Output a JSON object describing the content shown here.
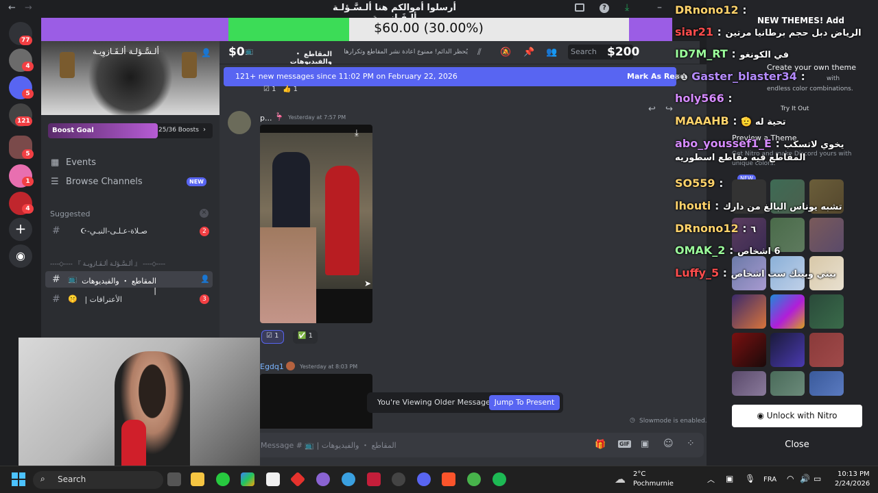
{
  "titlebar": {
    "back_arrow": "←",
    "forward_arrow": "→",
    "title": "أرسلوا أموالكم هنا ألـسَّـؤلـة ألـفَـازوِيـة"
  },
  "server_rail": {
    "badges": [
      "77",
      "4",
      "5",
      "121",
      "5",
      "1",
      "4"
    ]
  },
  "sidebar": {
    "server_name": "ألـسَّـؤلـة ألـفَـازوِيـة",
    "boost_goal_label": "Boost Goal",
    "boost_count": "25/36 Boosts",
    "events_label": "Events",
    "browse_channels_label": "Browse Channels",
    "new_badge": "NEW",
    "suggested_label": "Suggested",
    "suggested_channel": "صـلاة-عـلـى-النبـي-☪",
    "suggested_badge": "2",
    "category_label": "----◇---- 『 ألـسَّـؤلـة ألـفَـازوِيـة 』 ----◇----",
    "channels": [
      {
        "name": "المقاطع ・ والفيديوهات |",
        "badge": ""
      },
      {
        "name": "الأعترافات |",
        "badge": "3"
      }
    ]
  },
  "goal_bar": {
    "text": "$60.00 (30.00%)",
    "progress_pct": 30
  },
  "channel_header": {
    "left_amount": "$0",
    "channel_name": "المقاطع ・ والفيديوهات",
    "topic": "يُحظر الدائم! ممنوع اعادة نشر المقاطع وتكرارها",
    "right_amount": "$200",
    "search_placeholder": "Search"
  },
  "chat": {
    "new_messages_banner": "121+ new messages since 11:02 PM on February 22, 2026",
    "mark_as_read": "Mark As Read",
    "messages": [
      {
        "username": "p...",
        "timestamp": "Yesterday at 7:57 PM",
        "reactions": [
          {
            "emoji": "☑",
            "count": "1"
          },
          {
            "emoji": "✅",
            "count": "1"
          }
        ]
      },
      {
        "username": "Egdq1",
        "timestamp": "Yesterday at 8:03 PM"
      }
    ],
    "older_messages_text": "You're Viewing Older Messages",
    "jump_to_present": "Jump To Present",
    "slowmode_text": "Slowmode is enabled.",
    "input_placeholder": "Message # 📺 | المقاطع ・ والفيديوهات"
  },
  "themes_panel": {
    "header": "NEW THEMES! Add",
    "promo_title": "Create your own theme",
    "promo_sub_1": "with",
    "promo_sub_2": "endless color combinations.",
    "try_it_out": "Try It Out",
    "preview_title": "Preview a Theme",
    "preview_sub": "Get Nitro and make Discord yours with unique colors.",
    "new_badge": "NEW",
    "unlock_nitro": "Unlock with Nitro",
    "close": "Close"
  },
  "chat_overlay": [
    {
      "user": "DRnono12",
      "color": "#ffd36b",
      "msg": ""
    },
    {
      "user": "siar21",
      "color": "#ff4d4d",
      "msg": "الرياض دبل حجم برطانيا مرتين"
    },
    {
      "user": "ID7M_RT",
      "color": "#9cff9c",
      "msg": "في الكونغو"
    },
    {
      "user": "Gaster_blaster34",
      "color": "#b58bff",
      "msg": ""
    },
    {
      "user": "holy566",
      "color": "#d68bff",
      "msg": ""
    },
    {
      "user": "MAAAHB",
      "color": "#ffd36b",
      "msg": "تحية له 🫡"
    },
    {
      "user": "abo_youssef1_E",
      "color": "#d68bff",
      "msg": "يخوي لاتسكب المقاطع فيه مقاطع اسطوريه"
    },
    {
      "user": "SO559",
      "color": "#ffd36b",
      "msg": ""
    },
    {
      "user": "lhouti",
      "color": "#ffd36b",
      "msg": "تشبه يوناس البالغ من دارك"
    },
    {
      "user": "DRnono12",
      "color": "#ffd36b",
      "msg": "٦"
    },
    {
      "user": "OMAK_2",
      "color": "#9cff9c",
      "msg": "6 اشخاص"
    },
    {
      "user": "Luffy_5",
      "color": "#ff4d4d",
      "msg": "بيني وبينك ست اشخاص"
    }
  ],
  "taskbar": {
    "search_label": "Search",
    "weather_temp": "2°C",
    "weather_location": "Pochmurnie",
    "language": "FRA",
    "time": "10:13 PM",
    "date": "2/24/2026"
  }
}
